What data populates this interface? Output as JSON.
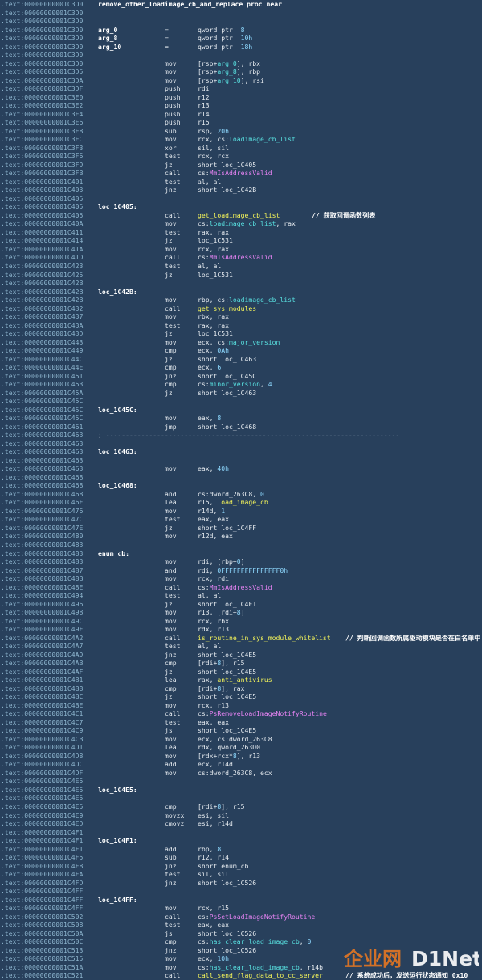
{
  "header": {
    "proc_line": {
      "addr": ".text:00000000001C3D0",
      "text": "remove_other_loadimage_cb_and_replace proc near"
    }
  },
  "lines": [
    {
      "a": ".text:00000000001C3D0",
      "l": "remove_other_loadimage_cb_and_replace proc near"
    },
    {
      "a": ".text:00000000001C3D0"
    },
    {
      "a": ".text:00000000001C3D0"
    },
    {
      "a": ".text:00000000001C3D0",
      "l": "arg_0",
      "m": "=",
      "o": [
        [
          "qword ptr  ",
          "w"
        ],
        [
          "8",
          "n"
        ]
      ]
    },
    {
      "a": ".text:00000000001C3D0",
      "l": "arg_8",
      "m": "=",
      "o": [
        [
          "qword ptr  ",
          "w"
        ],
        [
          "10h",
          "n"
        ]
      ]
    },
    {
      "a": ".text:00000000001C3D0",
      "l": "arg_10",
      "m": "=",
      "o": [
        [
          "qword ptr  ",
          "w"
        ],
        [
          "18h",
          "n"
        ]
      ]
    },
    {
      "a": ".text:00000000001C3D0"
    },
    {
      "a": ".text:00000000001C3D0",
      "m": "mov",
      "o": [
        [
          "[rsp+",
          "w"
        ],
        [
          "arg_0",
          "c"
        ],
        [
          "], rbx",
          "w"
        ]
      ]
    },
    {
      "a": ".text:00000000001C3D5",
      "m": "mov",
      "o": [
        [
          "[rsp+",
          "w"
        ],
        [
          "arg_8",
          "c"
        ],
        [
          "], rbp",
          "w"
        ]
      ]
    },
    {
      "a": ".text:00000000001C3DA",
      "m": "mov",
      "o": [
        [
          "[rsp+",
          "w"
        ],
        [
          "arg_10",
          "c"
        ],
        [
          "], rsi",
          "w"
        ]
      ]
    },
    {
      "a": ".text:00000000001C3DF",
      "m": "push",
      "o": [
        [
          "rdi",
          "w"
        ]
      ]
    },
    {
      "a": ".text:00000000001C3E0",
      "m": "push",
      "o": [
        [
          "r12",
          "w"
        ]
      ]
    },
    {
      "a": ".text:00000000001C3E2",
      "m": "push",
      "o": [
        [
          "r13",
          "w"
        ]
      ]
    },
    {
      "a": ".text:00000000001C3E4",
      "m": "push",
      "o": [
        [
          "r14",
          "w"
        ]
      ]
    },
    {
      "a": ".text:00000000001C3E6",
      "m": "push",
      "o": [
        [
          "r15",
          "w"
        ]
      ]
    },
    {
      "a": ".text:00000000001C3E8",
      "m": "sub",
      "o": [
        [
          "rsp, ",
          "w"
        ],
        [
          "20h",
          "n"
        ]
      ]
    },
    {
      "a": ".text:00000000001C3EC",
      "m": "mov",
      "o": [
        [
          "rcx, cs:",
          "w"
        ],
        [
          "loadimage_cb_list",
          "c"
        ]
      ]
    },
    {
      "a": ".text:00000000001C3F3",
      "m": "xor",
      "o": [
        [
          "sil, sil",
          "w"
        ]
      ]
    },
    {
      "a": ".text:00000000001C3F6",
      "m": "test",
      "o": [
        [
          "rcx, rcx",
          "w"
        ]
      ]
    },
    {
      "a": ".text:00000000001C3F9",
      "m": "jz",
      "o": [
        [
          "short loc_1C405",
          "w"
        ]
      ]
    },
    {
      "a": ".text:00000000001C3FB",
      "m": "call",
      "o": [
        [
          "cs:",
          "w"
        ],
        [
          "MmIsAddressValid",
          "m"
        ]
      ]
    },
    {
      "a": ".text:00000000001C401",
      "m": "test",
      "o": [
        [
          "al, al",
          "w"
        ]
      ]
    },
    {
      "a": ".text:00000000001C403",
      "m": "jnz",
      "o": [
        [
          "short loc_1C42B",
          "w"
        ]
      ]
    },
    {
      "a": ".text:00000000001C405"
    },
    {
      "a": ".text:00000000001C405",
      "l": "loc_1C405:"
    },
    {
      "a": ".text:00000000001C405",
      "m": "call",
      "o": [
        [
          "get_loadimage_cb_list",
          "y"
        ]
      ],
      "c": "// 获取回调函数列表"
    },
    {
      "a": ".text:00000000001C40A",
      "m": "mov",
      "o": [
        [
          "cs:",
          "w"
        ],
        [
          "loadimage_cb_list",
          "c"
        ],
        [
          ", rax",
          "w"
        ]
      ]
    },
    {
      "a": ".text:00000000001C411",
      "m": "test",
      "o": [
        [
          "rax, rax",
          "w"
        ]
      ]
    },
    {
      "a": ".text:00000000001C414",
      "m": "jz",
      "o": [
        [
          "loc_1C531",
          "w"
        ]
      ]
    },
    {
      "a": ".text:00000000001C41A",
      "m": "mov",
      "o": [
        [
          "rcx, rax",
          "w"
        ]
      ]
    },
    {
      "a": ".text:00000000001C41D",
      "m": "call",
      "o": [
        [
          "cs:",
          "w"
        ],
        [
          "MmIsAddressValid",
          "m"
        ]
      ]
    },
    {
      "a": ".text:00000000001C423",
      "m": "test",
      "o": [
        [
          "al, al",
          "w"
        ]
      ]
    },
    {
      "a": ".text:00000000001C425",
      "m": "jz",
      "o": [
        [
          "loc_1C531",
          "w"
        ]
      ]
    },
    {
      "a": ".text:00000000001C42B"
    },
    {
      "a": ".text:00000000001C42B",
      "l": "loc_1C42B:"
    },
    {
      "a": ".text:00000000001C42B",
      "m": "mov",
      "o": [
        [
          "rbp, cs:",
          "w"
        ],
        [
          "loadimage_cb_list",
          "c"
        ]
      ]
    },
    {
      "a": ".text:00000000001C432",
      "m": "call",
      "o": [
        [
          "get_sys_modules",
          "y"
        ]
      ]
    },
    {
      "a": ".text:00000000001C437",
      "m": "mov",
      "o": [
        [
          "rbx, rax",
          "w"
        ]
      ]
    },
    {
      "a": ".text:00000000001C43A",
      "m": "test",
      "o": [
        [
          "rax, rax",
          "w"
        ]
      ]
    },
    {
      "a": ".text:00000000001C43D",
      "m": "jz",
      "o": [
        [
          "loc_1C531",
          "w"
        ]
      ]
    },
    {
      "a": ".text:00000000001C443",
      "m": "mov",
      "o": [
        [
          "ecx, cs:",
          "w"
        ],
        [
          "major_version",
          "c"
        ]
      ]
    },
    {
      "a": ".text:00000000001C449",
      "m": "cmp",
      "o": [
        [
          "ecx, ",
          "w"
        ],
        [
          "0Ah",
          "n"
        ]
      ]
    },
    {
      "a": ".text:00000000001C44C",
      "m": "jz",
      "o": [
        [
          "short loc_1C463",
          "w"
        ]
      ]
    },
    {
      "a": ".text:00000000001C44E",
      "m": "cmp",
      "o": [
        [
          "ecx, ",
          "w"
        ],
        [
          "6",
          "n"
        ]
      ]
    },
    {
      "a": ".text:00000000001C451",
      "m": "jnz",
      "o": [
        [
          "short loc_1C45C",
          "w"
        ]
      ]
    },
    {
      "a": ".text:00000000001C453",
      "m": "cmp",
      "o": [
        [
          "cs:",
          "w"
        ],
        [
          "minor_version",
          "c"
        ],
        [
          ", ",
          "w"
        ],
        [
          "4",
          "n"
        ]
      ]
    },
    {
      "a": ".text:00000000001C45A",
      "m": "jz",
      "o": [
        [
          "short loc_1C463",
          "w"
        ]
      ]
    },
    {
      "a": ".text:00000000001C45C"
    },
    {
      "a": ".text:00000000001C45C",
      "l": "loc_1C45C:"
    },
    {
      "a": ".text:00000000001C45C",
      "m": "mov",
      "o": [
        [
          "eax, ",
          "w"
        ],
        [
          "8",
          "n"
        ]
      ]
    },
    {
      "a": ".text:00000000001C461",
      "m": "jmp",
      "o": [
        [
          "short loc_1C468",
          "w"
        ]
      ]
    },
    {
      "a": ".text:00000000001C463",
      "s": "; ---------------------------------------------------------------------------"
    },
    {
      "a": ".text:00000000001C463"
    },
    {
      "a": ".text:00000000001C463",
      "l": "loc_1C463:"
    },
    {
      "a": ".text:00000000001C463"
    },
    {
      "a": ".text:00000000001C463",
      "m": "mov",
      "o": [
        [
          "eax, ",
          "w"
        ],
        [
          "40h",
          "n"
        ]
      ]
    },
    {
      "a": ".text:00000000001C468"
    },
    {
      "a": ".text:00000000001C468",
      "l": "loc_1C468:"
    },
    {
      "a": ".text:00000000001C468",
      "m": "and",
      "o": [
        [
          "cs:dword_263C8, ",
          "w"
        ],
        [
          "0",
          "n"
        ]
      ]
    },
    {
      "a": ".text:00000000001C46F",
      "m": "lea",
      "o": [
        [
          "r15, ",
          "w"
        ],
        [
          "load_image_cb",
          "y"
        ]
      ]
    },
    {
      "a": ".text:00000000001C476",
      "m": "mov",
      "o": [
        [
          "r14d, ",
          "w"
        ],
        [
          "1",
          "n"
        ]
      ]
    },
    {
      "a": ".text:00000000001C47C",
      "m": "test",
      "o": [
        [
          "eax, eax",
          "w"
        ]
      ]
    },
    {
      "a": ".text:00000000001C47E",
      "m": "jz",
      "o": [
        [
          "short loc_1C4FF",
          "w"
        ]
      ]
    },
    {
      "a": ".text:00000000001C480",
      "m": "mov",
      "o": [
        [
          "r12d, eax",
          "w"
        ]
      ]
    },
    {
      "a": ".text:00000000001C483"
    },
    {
      "a": ".text:00000000001C483",
      "l": "enum_cb:"
    },
    {
      "a": ".text:00000000001C483",
      "m": "mov",
      "o": [
        [
          "rdi, [rbp+",
          "w"
        ],
        [
          "0",
          "n"
        ],
        [
          "]",
          "w"
        ]
      ]
    },
    {
      "a": ".text:00000000001C487",
      "m": "and",
      "o": [
        [
          "rdi, ",
          "w"
        ],
        [
          "0FFFFFFFFFFFFFFF0h",
          "n"
        ]
      ]
    },
    {
      "a": ".text:00000000001C48B",
      "m": "mov",
      "o": [
        [
          "rcx, rdi",
          "w"
        ]
      ]
    },
    {
      "a": ".text:00000000001C48E",
      "m": "call",
      "o": [
        [
          "cs:",
          "w"
        ],
        [
          "MmIsAddressValid",
          "m"
        ]
      ]
    },
    {
      "a": ".text:00000000001C494",
      "m": "test",
      "o": [
        [
          "al, al",
          "w"
        ]
      ]
    },
    {
      "a": ".text:00000000001C496",
      "m": "jz",
      "o": [
        [
          "short loc_1C4F1",
          "w"
        ]
      ]
    },
    {
      "a": ".text:00000000001C498",
      "m": "mov",
      "o": [
        [
          "r13, [rdi+",
          "w"
        ],
        [
          "8",
          "n"
        ],
        [
          "]",
          "w"
        ]
      ]
    },
    {
      "a": ".text:00000000001C49C",
      "m": "mov",
      "o": [
        [
          "rcx, rbx",
          "w"
        ]
      ]
    },
    {
      "a": ".text:00000000001C49F",
      "m": "mov",
      "o": [
        [
          "rdx, r13",
          "w"
        ]
      ]
    },
    {
      "a": ".text:00000000001C4A2",
      "m": "call",
      "o": [
        [
          "is_routine_in_sys_module_whitelist",
          "y"
        ]
      ],
      "c": "// 判断回调函数所属驱动模块是否在白名单中",
      "cw": true
    },
    {
      "a": ".text:00000000001C4A7",
      "m": "test",
      "o": [
        [
          "al, al",
          "w"
        ]
      ]
    },
    {
      "a": ".text:00000000001C4A9",
      "m": "jnz",
      "o": [
        [
          "short loc_1C4E5",
          "w"
        ]
      ]
    },
    {
      "a": ".text:00000000001C4AB",
      "m": "cmp",
      "o": [
        [
          "[rdi+",
          "w"
        ],
        [
          "8",
          "n"
        ],
        [
          "], r15",
          "w"
        ]
      ]
    },
    {
      "a": ".text:00000000001C4AF",
      "m": "jz",
      "o": [
        [
          "short loc_1C4E5",
          "w"
        ]
      ]
    },
    {
      "a": ".text:00000000001C4B1",
      "m": "lea",
      "o": [
        [
          "rax, ",
          "w"
        ],
        [
          "anti_antivirus",
          "y"
        ]
      ]
    },
    {
      "a": ".text:00000000001C4B8",
      "m": "cmp",
      "o": [
        [
          "[rdi+",
          "w"
        ],
        [
          "8",
          "n"
        ],
        [
          "], rax",
          "w"
        ]
      ]
    },
    {
      "a": ".text:00000000001C4BC",
      "m": "jz",
      "o": [
        [
          "short loc_1C4E5",
          "w"
        ]
      ]
    },
    {
      "a": ".text:00000000001C4BE",
      "m": "mov",
      "o": [
        [
          "rcx, r13",
          "w"
        ]
      ]
    },
    {
      "a": ".text:00000000001C4C1",
      "m": "call",
      "o": [
        [
          "cs:",
          "w"
        ],
        [
          "PsRemoveLoadImageNotifyRoutine",
          "m"
        ]
      ]
    },
    {
      "a": ".text:00000000001C4C7",
      "m": "test",
      "o": [
        [
          "eax, eax",
          "w"
        ]
      ]
    },
    {
      "a": ".text:00000000001C4C9",
      "m": "js",
      "o": [
        [
          "short loc_1C4E5",
          "w"
        ]
      ]
    },
    {
      "a": ".text:00000000001C4CB",
      "m": "mov",
      "o": [
        [
          "ecx, cs:dword_263C8",
          "w"
        ]
      ]
    },
    {
      "a": ".text:00000000001C4D1",
      "m": "lea",
      "o": [
        [
          "rdx, qword_263D0",
          "w"
        ]
      ]
    },
    {
      "a": ".text:00000000001C4D8",
      "m": "mov",
      "o": [
        [
          "[rdx+rcx*",
          "w"
        ],
        [
          "8",
          "n"
        ],
        [
          "], r13",
          "w"
        ]
      ]
    },
    {
      "a": ".text:00000000001C4DC",
      "m": "add",
      "o": [
        [
          "ecx, r14d",
          "w"
        ]
      ]
    },
    {
      "a": ".text:00000000001C4DF",
      "m": "mov",
      "o": [
        [
          "cs:dword_263C8, ecx",
          "w"
        ]
      ]
    },
    {
      "a": ".text:00000000001C4E5"
    },
    {
      "a": ".text:00000000001C4E5",
      "l": "loc_1C4E5:"
    },
    {
      "a": ".text:00000000001C4E5"
    },
    {
      "a": ".text:00000000001C4E5",
      "m": "cmp",
      "o": [
        [
          "[rdi+",
          "w"
        ],
        [
          "8",
          "n"
        ],
        [
          "], r15",
          "w"
        ]
      ]
    },
    {
      "a": ".text:00000000001C4E9",
      "m": "movzx",
      "o": [
        [
          "esi, sil",
          "w"
        ]
      ]
    },
    {
      "a": ".text:00000000001C4ED",
      "m": "cmovz",
      "o": [
        [
          "esi, r14d",
          "w"
        ]
      ]
    },
    {
      "a": ".text:00000000001C4F1"
    },
    {
      "a": ".text:00000000001C4F1",
      "l": "loc_1C4F1:"
    },
    {
      "a": ".text:00000000001C4F1",
      "m": "add",
      "o": [
        [
          "rbp, ",
          "w"
        ],
        [
          "8",
          "n"
        ]
      ]
    },
    {
      "a": ".text:00000000001C4F5",
      "m": "sub",
      "o": [
        [
          "r12, r14",
          "w"
        ]
      ]
    },
    {
      "a": ".text:00000000001C4F8",
      "m": "jnz",
      "o": [
        [
          "short enum_cb",
          "w"
        ]
      ]
    },
    {
      "a": ".text:00000000001C4FA",
      "m": "test",
      "o": [
        [
          "sil, sil",
          "w"
        ]
      ]
    },
    {
      "a": ".text:00000000001C4FD",
      "m": "jnz",
      "o": [
        [
          "short loc_1C526",
          "w"
        ]
      ]
    },
    {
      "a": ".text:00000000001C4FF"
    },
    {
      "a": ".text:00000000001C4FF",
      "l": "loc_1C4FF:"
    },
    {
      "a": ".text:00000000001C4FF",
      "m": "mov",
      "o": [
        [
          "rcx, r15",
          "w"
        ]
      ]
    },
    {
      "a": ".text:00000000001C502",
      "m": "call",
      "o": [
        [
          "cs:",
          "w"
        ],
        [
          "PsSetLoadImageNotifyRoutine",
          "m"
        ]
      ]
    },
    {
      "a": ".text:00000000001C508",
      "m": "test",
      "o": [
        [
          "eax, eax",
          "w"
        ]
      ]
    },
    {
      "a": ".text:00000000001C50A",
      "m": "js",
      "o": [
        [
          "short loc_1C526",
          "w"
        ]
      ]
    },
    {
      "a": ".text:00000000001C50C",
      "m": "cmp",
      "o": [
        [
          "cs:",
          "w"
        ],
        [
          "has_clear_load_image_cb",
          "c"
        ],
        [
          ", ",
          "w"
        ],
        [
          "0",
          "n"
        ]
      ]
    },
    {
      "a": ".text:00000000001C513",
      "m": "jnz",
      "o": [
        [
          "short loc_1C526",
          "w"
        ]
      ]
    },
    {
      "a": ".text:00000000001C515",
      "m": "mov",
      "o": [
        [
          "ecx, ",
          "w"
        ],
        [
          "10h",
          "n"
        ]
      ]
    },
    {
      "a": ".text:00000000001C51A",
      "m": "mov",
      "o": [
        [
          "cs:",
          "w"
        ],
        [
          "has_clear_load_image_cb",
          "c"
        ],
        [
          ", r14b",
          "w"
        ]
      ]
    },
    {
      "a": ".text:00000000001C521",
      "m": "call",
      "o": [
        [
          "call_send_flag_data_to_cc_server",
          "y"
        ]
      ],
      "c": "// 系统成功后，发送运行状态通知 0x10",
      "cw": true
    }
  ],
  "watermark": {
    "logo_text_1": "企业网",
    "logo_text_2": "D1Net"
  },
  "colors": {
    "background": "#28405c",
    "address": "#8eb6cf",
    "function_name": "#f5f55a",
    "variable": "#58e0e0",
    "api_import": "#e884f5",
    "number": "#8ed9ff",
    "logo_orange": "#f07a1e"
  }
}
